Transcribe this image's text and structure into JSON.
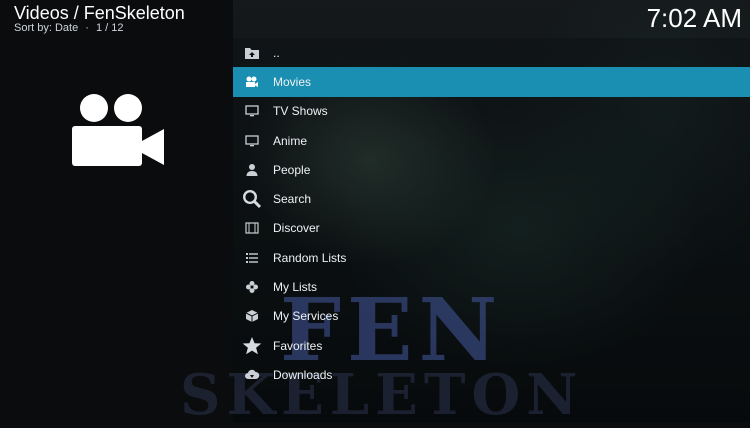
{
  "header": {
    "title": "Videos / FenSkeleton",
    "sort": "Sort by: Date",
    "separator": "·",
    "position": "1 / 12",
    "clock": "7:02 AM"
  },
  "background": {
    "logo_line1": "FEN",
    "logo_line2": "SKELETON"
  },
  "selected_color": "#1a8fb1",
  "menu": [
    {
      "label": "..",
      "icon": "folder-up-icon"
    },
    {
      "label": "Movies",
      "icon": "movies-icon"
    },
    {
      "label": "TV Shows",
      "icon": "tv-icon"
    },
    {
      "label": "Anime",
      "icon": "monitor-icon"
    },
    {
      "label": "People",
      "icon": "person-icon"
    },
    {
      "label": "Search",
      "icon": "search-icon"
    },
    {
      "label": "Discover",
      "icon": "film-strip-icon"
    },
    {
      "label": "Random Lists",
      "icon": "list-icon"
    },
    {
      "label": "My Lists",
      "icon": "flower-icon"
    },
    {
      "label": "My Services",
      "icon": "box-icon"
    },
    {
      "label": "Favorites",
      "icon": "star-icon"
    },
    {
      "label": "Downloads",
      "icon": "cloud-download-icon"
    }
  ]
}
